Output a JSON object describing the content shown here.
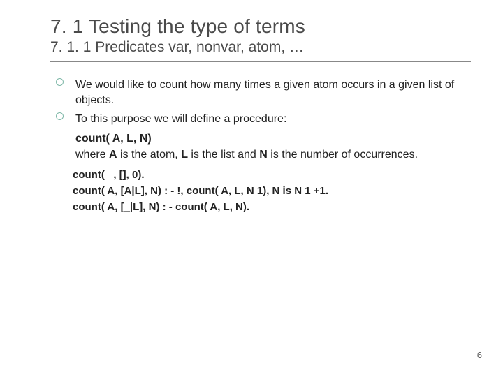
{
  "title": "7. 1 Testing the type of terms",
  "subtitle": "7. 1. 1 Predicates var, nonvar, atom, …",
  "bullets": [
    {
      "text": "We would like to count how many times a given atom occurs in a given list of objects."
    },
    {
      "text": "To this purpose we will define a procedure:"
    }
  ],
  "proc_sig": "count( A, L, N)",
  "proc_desc_pre": "where ",
  "proc_desc_a": "A",
  "proc_desc_mid1": " is the atom, ",
  "proc_desc_l": "L",
  "proc_desc_mid2": " is the list and ",
  "proc_desc_n": "N",
  "proc_desc_post": " is the number of occurrences.",
  "code": [
    "count( _, [], 0).",
    "count( A, [A|L], N) : - !, count( A, L, N 1), N is N 1 +1.",
    "count( A, [_|L], N) : - count( A, L, N)."
  ],
  "page_number": "6"
}
